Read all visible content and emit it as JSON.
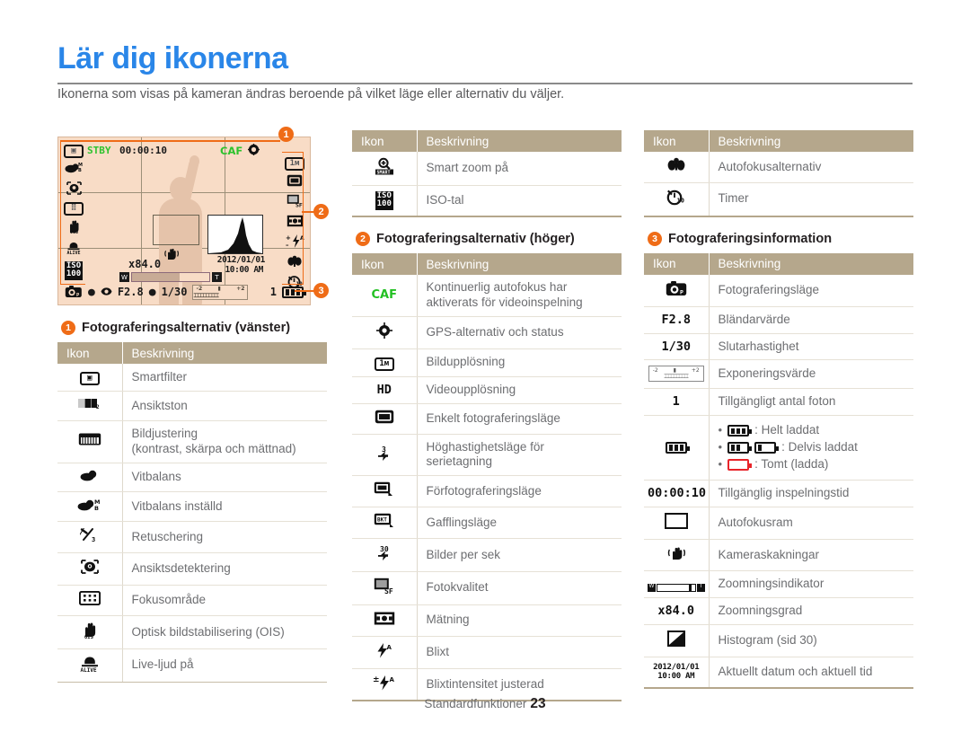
{
  "page": {
    "title": "Lär dig ikonerna",
    "intro": "Ikonerna som visas på kameran ändras beroende på vilket läge eller alternativ du väljer.",
    "footer_label": "Standardfunktioner",
    "footer_page": "23",
    "accent_color": "#2a86e8",
    "marker_color": "#ef6c17",
    "table_header_color": "#b5a78c"
  },
  "lcd": {
    "stby_label": "STBY",
    "stby_time": "00:00:10",
    "caf_label": "CAF",
    "resolution": "1м",
    "zoom_ratio": "x84.0",
    "zoom_wide": "W",
    "zoom_tele": "T",
    "date": "2012/01/01",
    "time": "10:00 AM",
    "aperture": "F2.8",
    "shutter": "1/30",
    "shots_left": "1",
    "ev_minus": "-2",
    "ev_plus": "+2",
    "left_icons": [
      "smart-filter",
      "white-balance-mb",
      "face-detect",
      "focus-area",
      "ois-hand",
      "live-sound",
      "iso-100"
    ],
    "right_icons": [
      "photo-size-1m",
      "single-shot",
      "photo-quality-sf",
      "metering",
      "flash-adjust",
      "macro-af",
      "timer"
    ]
  },
  "markers": {
    "one": "1",
    "two": "2",
    "three": "3"
  },
  "sections": [
    {
      "id": "left-options",
      "badge": "1",
      "heading": "Fotograferingsalternativ (vänster)",
      "columns": {
        "icon": "Ikon",
        "description": "Beskrivning"
      },
      "rows": [
        {
          "icon": "smart-filter-icon",
          "desc": "Smartfilter"
        },
        {
          "icon": "face-tone-icon",
          "desc": "Ansiktston"
        },
        {
          "icon": "image-adjust-icon",
          "desc": "Bildjustering\n(kontrast, skärpa och mättnad)"
        },
        {
          "icon": "white-balance-icon",
          "desc": "Vitbalans"
        },
        {
          "icon": "white-balance-custom-icon",
          "desc": "Vitbalans inställd"
        },
        {
          "icon": "retouch-icon",
          "desc": "Retuschering"
        },
        {
          "icon": "face-detection-icon",
          "desc": "Ansiktsdetektering"
        },
        {
          "icon": "focus-area-icon",
          "desc": "Fokusområde"
        },
        {
          "icon": "ois-icon",
          "desc": "Optisk bildstabilisering (OIS)"
        },
        {
          "icon": "live-sound-icon",
          "desc": "Live-ljud på"
        },
        {
          "icon": "smart-zoom-icon",
          "desc": "Smart zoom på"
        },
        {
          "icon": "iso-icon",
          "desc": "ISO-tal"
        }
      ]
    },
    {
      "id": "right-options",
      "badge": "2",
      "heading": "Fotograferingsalternativ (höger)",
      "columns": {
        "icon": "Ikon",
        "description": "Beskrivning"
      },
      "rows": [
        {
          "icon": "caf-icon",
          "desc": "Kontinuerlig autofokus har\naktiverats för videoinspelning"
        },
        {
          "icon": "gps-icon",
          "desc": "GPS-alternativ och status"
        },
        {
          "icon": "photo-resolution-icon",
          "desc": "Bildupplösning"
        },
        {
          "icon": "video-resolution-icon",
          "desc": "Videoupplösning"
        },
        {
          "icon": "single-shot-icon",
          "desc": "Enkelt fotograferingsläge"
        },
        {
          "icon": "burst-icon",
          "desc": "Höghastighetsläge för serietagning"
        },
        {
          "icon": "precapture-icon",
          "desc": "Förfotograferingsläge"
        },
        {
          "icon": "bracket-icon",
          "desc": "Gafflingsläge"
        },
        {
          "icon": "fps-icon",
          "desc": "Bilder per sek"
        },
        {
          "icon": "photo-quality-icon",
          "desc": "Fotokvalitet"
        },
        {
          "icon": "metering-icon",
          "desc": "Mätning"
        },
        {
          "icon": "flash-icon",
          "desc": "Blixt"
        },
        {
          "icon": "flash-intensity-icon",
          "desc": "Blixtintensitet justerad"
        }
      ]
    },
    {
      "id": "shooting-info",
      "badge": "3",
      "heading": "Fotograferingsinformation",
      "columns": {
        "icon": "Ikon",
        "description": "Beskrivning"
      },
      "top_rows": [
        {
          "icon": "macro-af-icon",
          "desc": "Autofokusalternativ"
        },
        {
          "icon": "timer-icon",
          "desc": "Timer"
        }
      ],
      "rows": [
        {
          "icon": "shooting-mode-icon",
          "desc": "Fotograferingsläge"
        },
        {
          "icon": "aperture-icon",
          "desc": "Bländarvärde"
        },
        {
          "icon": "shutter-icon",
          "desc": "Slutarhastighet"
        },
        {
          "icon": "exposure-value-icon",
          "desc": "Exponeringsvärde"
        },
        {
          "icon": "shots-available-icon",
          "desc": "Tillgängligt antal foton"
        },
        {
          "icon": "battery-icon",
          "desc": ""
        },
        {
          "icon": "recording-time-icon",
          "desc": "Tillgänglig inspelningstid"
        },
        {
          "icon": "af-frame-icon",
          "desc": "Autofokusram"
        },
        {
          "icon": "camera-shake-icon",
          "desc": "Kameraskakningar"
        },
        {
          "icon": "zoom-indicator-icon",
          "desc": "Zoomningsindikator"
        },
        {
          "icon": "zoom-ratio-icon",
          "desc": "Zoomningsgrad"
        },
        {
          "icon": "histogram-icon",
          "desc": "Histogram (sid 30)"
        },
        {
          "icon": "datetime-icon",
          "desc": "Aktuellt datum och aktuell tid"
        }
      ],
      "battery_states": [
        {
          "label": ": Helt laddat",
          "state": "full"
        },
        {
          "label": ": Delvis laddat",
          "state": "partial"
        },
        {
          "label": ": Tomt (ladda)",
          "state": "empty"
        }
      ],
      "values": {
        "aperture": "F2.8",
        "shutter": "1/30",
        "shots": "1",
        "rec_time": "00:00:10",
        "zoom_ratio": "x84.0",
        "date": "2012/01/01",
        "time": "10:00 AM"
      }
    }
  ]
}
